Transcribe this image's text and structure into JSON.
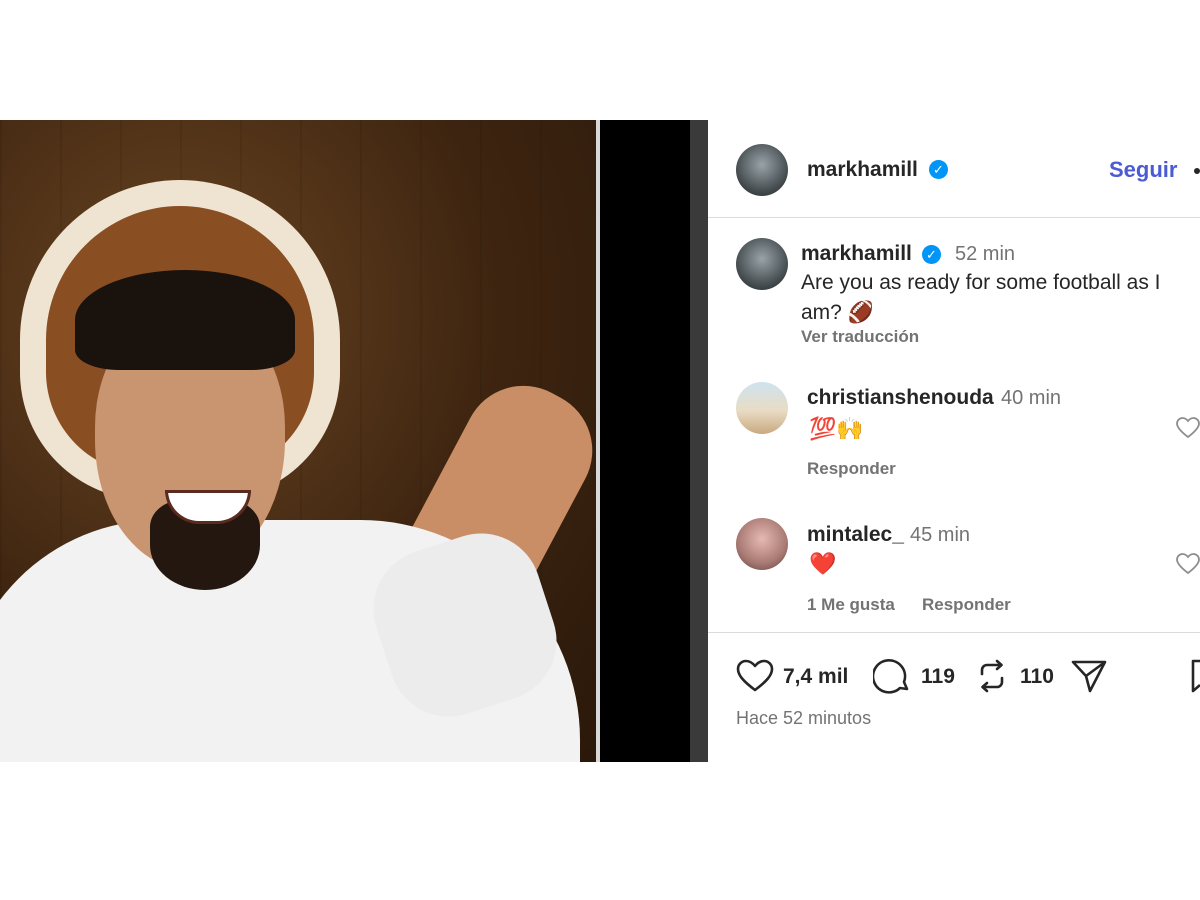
{
  "post": {
    "author": "markhamill",
    "follow_label": "Seguir",
    "caption_time": "52 min",
    "caption_line1": "Are you as ready for some football as I",
    "caption_line2": "am?",
    "caption_emoji": "🏈",
    "translate_label": "Ver traducción",
    "posted_ago": "Hace 52 minutos"
  },
  "comments": [
    {
      "username": "christianshenouda",
      "time": "40 min",
      "text": "💯🙌",
      "reply_label": "Responder",
      "likes_label": ""
    },
    {
      "username": "mintalec_",
      "time": "45 min",
      "text": "❤️",
      "reply_label": "Responder",
      "likes_label": "1 Me gusta"
    }
  ],
  "actions": {
    "likes": "7,4 mil",
    "comments": "119",
    "reposts": "110"
  },
  "colors": {
    "accent": "#4a5bd4",
    "verified": "#0095f6",
    "text_secondary": "#737373"
  },
  "icons": [
    "heart-icon",
    "comment-icon",
    "repost-icon",
    "share-icon",
    "bookmark-icon",
    "verified-icon",
    "more-icon"
  ]
}
